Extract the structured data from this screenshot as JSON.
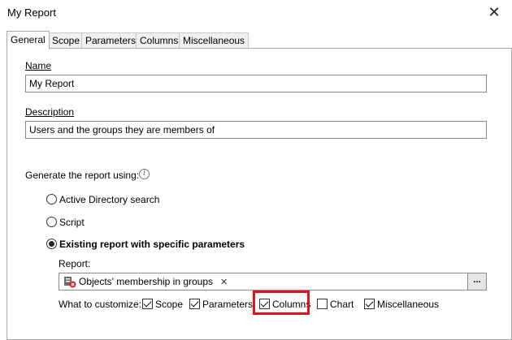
{
  "window": {
    "title": "My Report"
  },
  "tabs": [
    {
      "label": "General",
      "active": true
    },
    {
      "label": "Scope"
    },
    {
      "label": "Parameters"
    },
    {
      "label": "Columns"
    },
    {
      "label": "Miscellaneous"
    }
  ],
  "general": {
    "name_label": "Name",
    "name_value": "My Report",
    "description_label": "Description",
    "description_value": "Users and the groups they are members of",
    "generate_label": "Generate the report using:",
    "options": [
      {
        "label": "Active Directory search",
        "selected": false
      },
      {
        "label": "Script",
        "selected": false
      },
      {
        "label": "Existing report with specific parameters",
        "selected": true
      }
    ],
    "report_label": "Report:",
    "report_value": "Objects' membership in groups",
    "browse_label": "...",
    "customize_label": "What to customize:",
    "customize": [
      {
        "label": "Scope",
        "checked": true
      },
      {
        "label": "Parameters",
        "checked": true
      },
      {
        "label": "Columns",
        "checked": true,
        "highlighted": true
      },
      {
        "label": "Chart",
        "checked": false
      },
      {
        "label": "Miscellaneous",
        "checked": true
      }
    ]
  },
  "colors": {
    "highlight": "#e0141e"
  }
}
